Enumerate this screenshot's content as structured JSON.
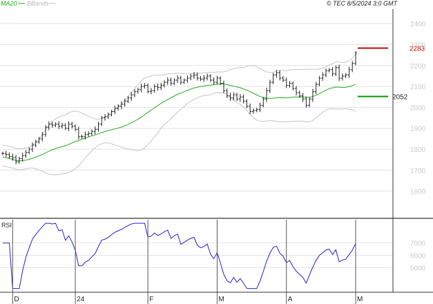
{
  "header": {
    "ma_label": "MA20",
    "bb_label": "BBands",
    "source_label": "© TEC 8/5/2024 3:0 GMT"
  },
  "colors": {
    "price": "#222222",
    "ma": "#22aa22",
    "bands": "#c4c4c4",
    "rsi": "#2222cc",
    "resistance": "#cc0000",
    "support": "#009900",
    "grid": "#e2e2e2",
    "frame": "#333333"
  },
  "chart_data": [
    {
      "type": "ohlc",
      "title": "",
      "ylim": [
        1470,
        2470
      ],
      "y_ticks": [
        1600,
        1700,
        1800,
        1900,
        2000,
        2100,
        2200,
        2300,
        2400
      ],
      "x_months": [
        "D",
        "24",
        "F",
        "M",
        "A",
        "M"
      ],
      "resistance": {
        "value": 2283,
        "label": "2283"
      },
      "support": {
        "value": 2052,
        "label": "2052"
      },
      "close": [
        1780,
        1775,
        1765,
        1760,
        1740,
        1755,
        1770,
        1785,
        1800,
        1820,
        1835,
        1850,
        1870,
        1905,
        1920,
        1915,
        1920,
        1910,
        1915,
        1900,
        1920,
        1910,
        1895,
        1860,
        1860,
        1870,
        1875,
        1885,
        1895,
        1920,
        1950,
        1955,
        1965,
        1980,
        1995,
        2005,
        2015,
        2030,
        2045,
        2060,
        2075,
        2085,
        2100,
        2105,
        2075,
        2080,
        2100,
        2095,
        2105,
        2120,
        2130,
        2115,
        2130,
        2140,
        2120,
        2130,
        2140,
        2150,
        2155,
        2140,
        2135,
        2140,
        2150,
        2130,
        2120,
        2140,
        2115,
        2080,
        2055,
        2045,
        2060,
        2040,
        2050,
        2030,
        2005,
        1980,
        1985,
        1990,
        2010,
        2040,
        2080,
        2120,
        2155,
        2165,
        2140,
        2130,
        2105,
        2115,
        2090,
        2070,
        2055,
        2040,
        2010,
        2040,
        2075,
        2110,
        2140,
        2155,
        2175,
        2180,
        2160,
        2190,
        2140,
        2150,
        2155,
        2180,
        2210,
        2260
      ],
      "rsi": {
        "label": "RSI",
        "ylim": [
          30,
          90
        ],
        "y_ticks": [
          50,
          60,
          70
        ],
        "tick_labels": [
          "5000",
          "6000",
          "7000"
        ]
      }
    }
  ]
}
